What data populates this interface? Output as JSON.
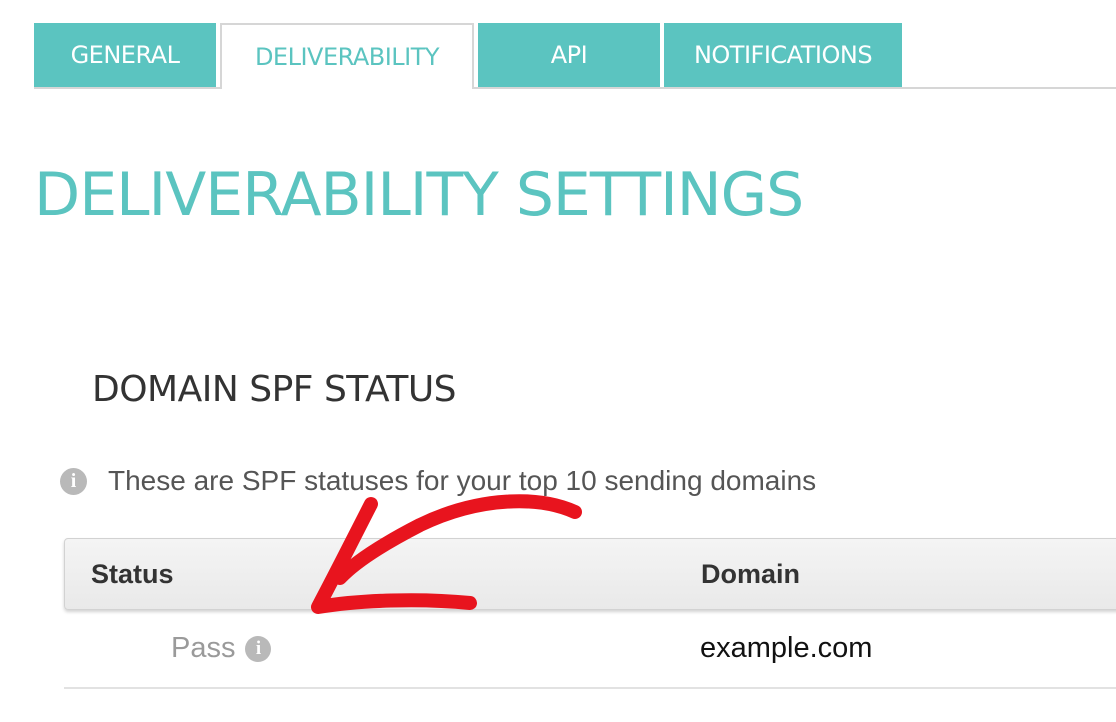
{
  "tabs": [
    {
      "label": "GENERAL",
      "active": false
    },
    {
      "label": "DELIVERABILITY",
      "active": true
    },
    {
      "label": "API",
      "active": false
    },
    {
      "label": "NOTIFICATIONS",
      "active": false
    }
  ],
  "page": {
    "title": "DELIVERABILITY SETTINGS"
  },
  "spf_section": {
    "title": "DOMAIN SPF STATUS",
    "info_text": "These are SPF statuses for your top 10 sending domains",
    "table": {
      "columns": [
        "Status",
        "Domain"
      ],
      "rows": [
        {
          "status": "Pass",
          "domain": "example.com"
        }
      ]
    }
  },
  "icons": {
    "info": "info-icon",
    "annotation": "red-arrow-annotation"
  },
  "colors": {
    "accent": "#5bc4c0",
    "annotation": "#e8141e"
  }
}
